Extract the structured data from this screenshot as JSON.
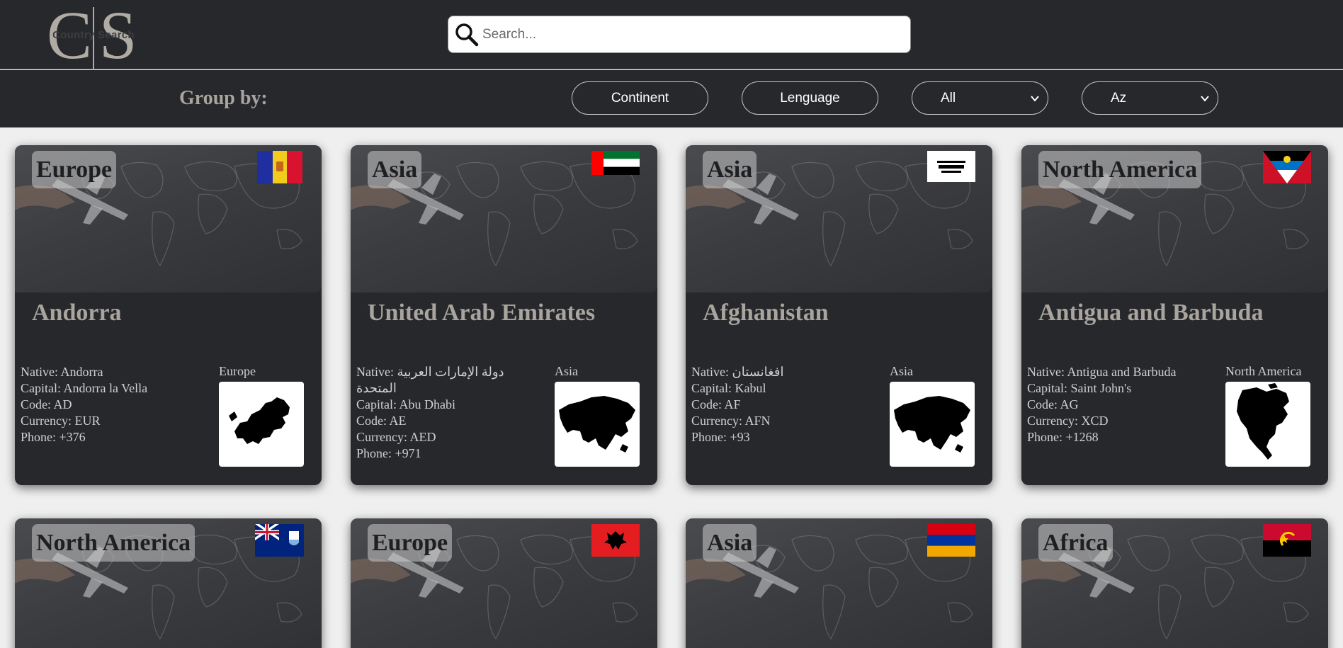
{
  "header": {
    "logo": {
      "letters": "CS",
      "text": "Country Search"
    },
    "search": {
      "placeholder": "Search...",
      "value": ""
    }
  },
  "toolbar": {
    "group_by_label": "Group by:",
    "buttons": [
      "Continent",
      "Lenguage"
    ],
    "filter_select": "All",
    "sort_select": "Az"
  },
  "labels": {
    "native": "Native:",
    "capital": "Capital:",
    "code": "Code:",
    "currency": "Currency:",
    "phone": "Phone:"
  },
  "cards": [
    {
      "continent": "Europe",
      "name": "Andorra",
      "native": "Andorra",
      "capital": "Andorra la Vella",
      "code": "AD",
      "currency": "EUR",
      "phone": "+376",
      "flag": "andorra",
      "map": "europe"
    },
    {
      "continent": "Asia",
      "name": "United Arab Emirates",
      "native": "دولة الإمارات العربية المتحدة",
      "capital": "Abu Dhabi",
      "code": "AE",
      "currency": "AED",
      "phone": "+971",
      "flag": "uae",
      "map": "asia"
    },
    {
      "continent": "Asia",
      "name": "Afghanistan",
      "native": "افغانستان",
      "capital": "Kabul",
      "code": "AF",
      "currency": "AFN",
      "phone": "+93",
      "flag": "afghanistan",
      "map": "asia"
    },
    {
      "continent": "North America",
      "name": "Antigua and Barbuda",
      "native": "Antigua and Barbuda",
      "capital": "Saint John's",
      "code": "AG",
      "currency": "XCD",
      "phone": "+1268",
      "flag": "antigua",
      "map": "north-america"
    },
    {
      "continent": "North America",
      "flag": "anguilla"
    },
    {
      "continent": "Europe",
      "flag": "albania"
    },
    {
      "continent": "Asia",
      "flag": "armenia"
    },
    {
      "continent": "Africa",
      "flag": "angola"
    }
  ],
  "colors": {
    "header_bg": "#27282c",
    "card_bg": "#27282c",
    "title_text": "#a9a59e",
    "page_bg": "#efefef"
  }
}
